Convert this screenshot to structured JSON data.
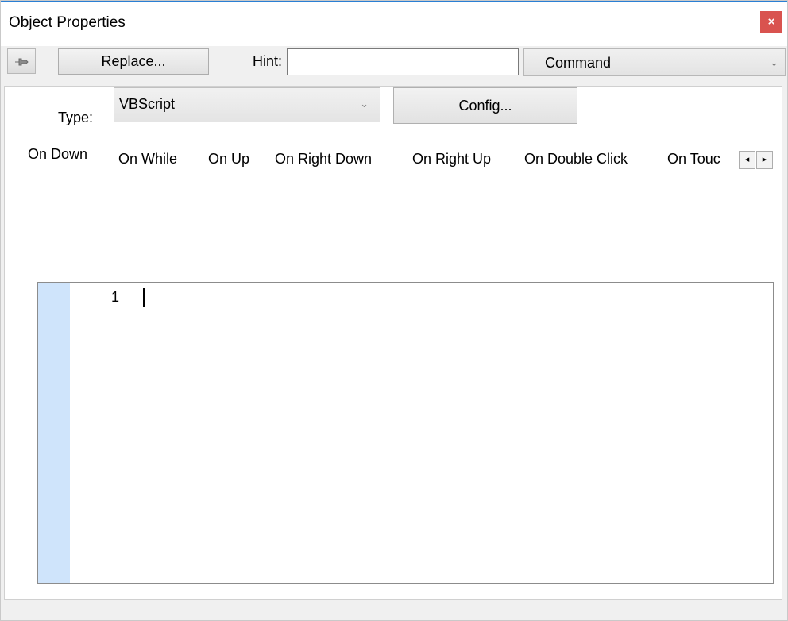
{
  "window": {
    "title": "Object Properties",
    "close_label": "×"
  },
  "toolbar": {
    "pin_icon": "pushpin-icon",
    "replace_label": "Replace...",
    "hint_label": "Hint:",
    "hint_value": "",
    "action_value": "Command"
  },
  "type_row": {
    "type_label": "Type:",
    "type_value": "VBScript",
    "config_label": "Config..."
  },
  "tabs": [
    {
      "label": "On Down",
      "active": true
    },
    {
      "label": "On While",
      "active": false
    },
    {
      "label": "On Up",
      "active": false
    },
    {
      "label": "On Right Down",
      "active": false
    },
    {
      "label": "On Right Up",
      "active": false
    },
    {
      "label": "On Double Click",
      "active": false
    },
    {
      "label": "On Touc",
      "active": false
    }
  ],
  "tab_scroll": {
    "left_glyph": "◂",
    "right_glyph": "▸"
  },
  "editor": {
    "line_numbers": [
      "1"
    ],
    "content": ""
  },
  "colors": {
    "accent": "#2a7fd4",
    "close": "#d9534f",
    "gutter_margin": "#cfe4fb"
  }
}
